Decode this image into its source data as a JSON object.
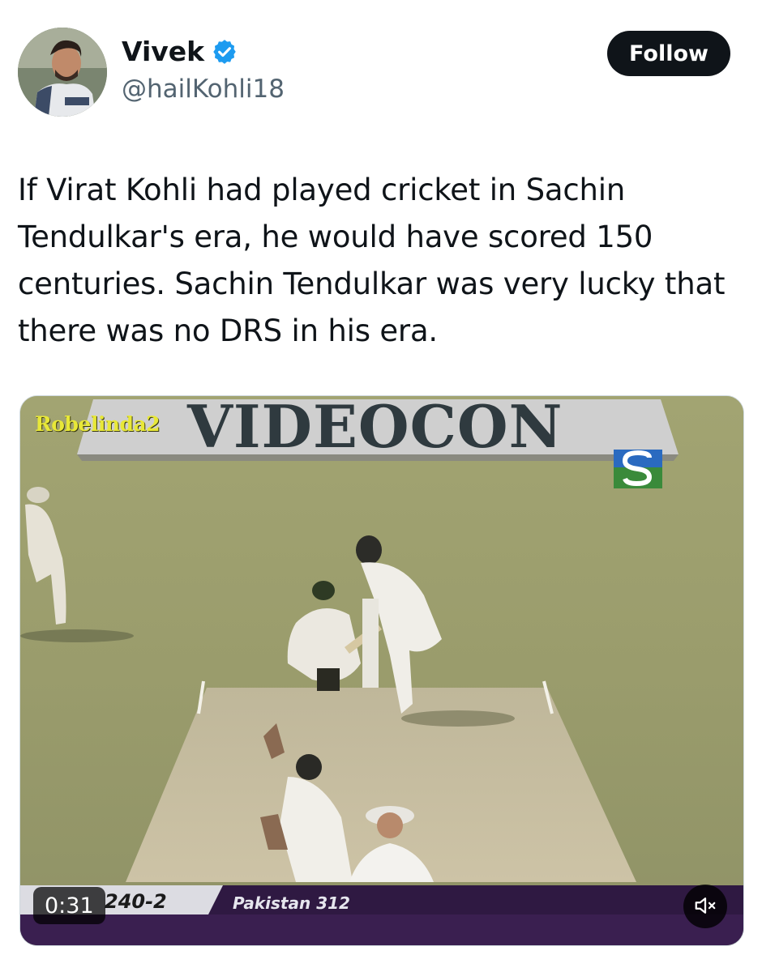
{
  "user": {
    "display_name": "Vivek",
    "handle": "@hailKohli18",
    "verified_icon": "verified-badge-icon",
    "verified_color": "#1d9bf0",
    "avatar_icon": "profile-photo"
  },
  "actions": {
    "follow_label": "Follow"
  },
  "tweet": {
    "text": "If Virat Kohli had played cricket in Sachin Tendulkar's era, he would have scored 150 centuries. Sachin Tendulkar was very lucky that there was no DRS in his era."
  },
  "video": {
    "watermark": "Robelinda2",
    "board_text": "VIDEOCON",
    "channel_logo_icon": "sony-channel-logo",
    "score_left": "240-2",
    "score_right": "Pakistan 312",
    "timestamp": "0:31",
    "mute_icon": "speaker-muted-icon"
  },
  "colors": {
    "text_primary": "#0f1419",
    "text_secondary": "#536471",
    "follow_bg": "#0f1419",
    "follow_text": "#ffffff"
  }
}
